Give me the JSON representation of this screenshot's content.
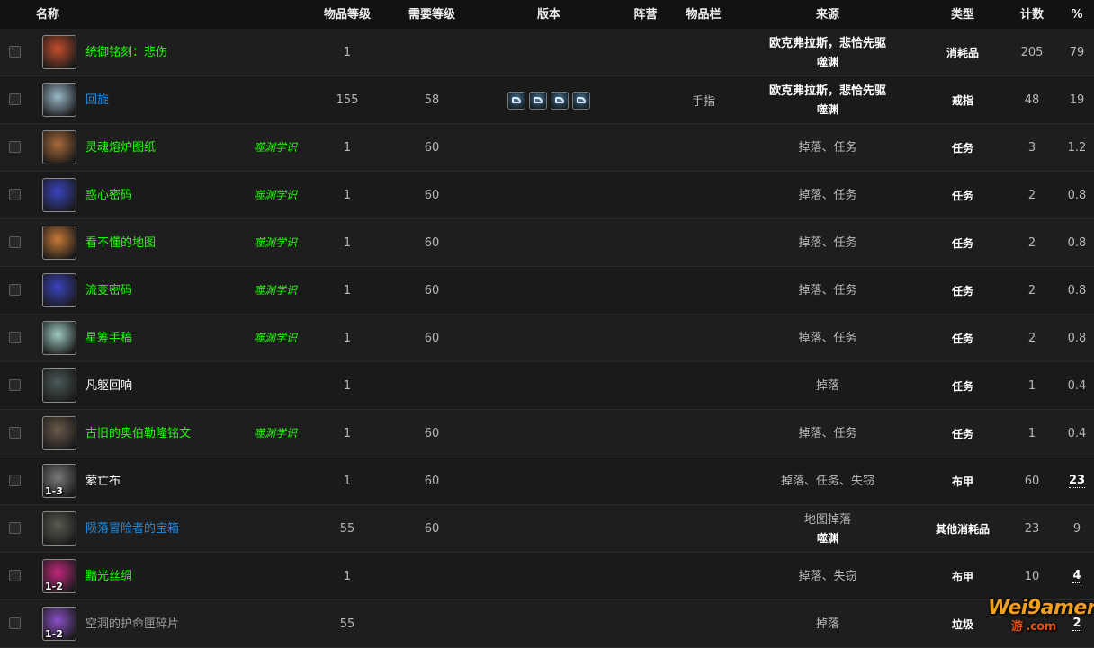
{
  "columns": {
    "name": "名称",
    "item_level": "物品等级",
    "req_level": "需要等级",
    "version": "版本",
    "faction": "阵营",
    "slot": "物品栏",
    "source": "来源",
    "type": "类型",
    "count": "计数",
    "percent": "%"
  },
  "icon_colors": {
    "icon_0": "#c44e2c",
    "icon_1": "#9ab8c8",
    "icon_2": "#a86a3a",
    "icon_3": "#3a44c0",
    "icon_4": "#c87a38",
    "icon_5": "#3a44c0",
    "icon_6": "#9ec8c0",
    "icon_7": "#4a5a58",
    "icon_8": "#6a5a4a",
    "icon_9": "#7a7a7a",
    "icon_10": "#5a5a50",
    "icon_11": "#c0287a",
    "icon_12": "#8a50c8"
  },
  "rows": [
    {
      "icon": "scroll-red-icon",
      "name": "统御铭刻：悲伤",
      "quality": "green",
      "tag": "",
      "item_level": "1",
      "req_level": "",
      "version_icons": 0,
      "slot": "",
      "source": "欧克弗拉斯，悲恰先驱",
      "source_strong": true,
      "zone": "噬渊",
      "type": "消耗品",
      "count": "205",
      "percent": "79",
      "pct_strong": false,
      "badge": ""
    },
    {
      "icon": "ring-icon",
      "name": "回旋",
      "quality": "blue",
      "tag": "",
      "item_level": "155",
      "req_level": "58",
      "version_icons": 4,
      "slot": "手指",
      "source": "欧克弗拉斯，悲恰先驱",
      "source_strong": true,
      "zone": "噬渊",
      "type": "戒指",
      "count": "48",
      "percent": "19",
      "pct_strong": false,
      "badge": ""
    },
    {
      "icon": "parchment-icon",
      "name": "灵魂熔炉图纸",
      "quality": "green",
      "tag": "噬渊学识",
      "item_level": "1",
      "req_level": "60",
      "version_icons": 0,
      "slot": "",
      "source": "掉落、任务",
      "source_strong": false,
      "zone": "",
      "type": "任务",
      "count": "3",
      "percent": "1.2",
      "pct_strong": false,
      "badge": ""
    },
    {
      "icon": "cipher-cube-icon",
      "name": "惑心密码",
      "quality": "green",
      "tag": "噬渊学识",
      "item_level": "1",
      "req_level": "60",
      "version_icons": 0,
      "slot": "",
      "source": "掉落、任务",
      "source_strong": false,
      "zone": "",
      "type": "任务",
      "count": "2",
      "percent": "0.8",
      "pct_strong": false,
      "badge": ""
    },
    {
      "icon": "map-icon",
      "name": "看不懂的地图",
      "quality": "green",
      "tag": "噬渊学识",
      "item_level": "1",
      "req_level": "60",
      "version_icons": 0,
      "slot": "",
      "source": "掉落、任务",
      "source_strong": false,
      "zone": "",
      "type": "任务",
      "count": "2",
      "percent": "0.8",
      "pct_strong": false,
      "badge": ""
    },
    {
      "icon": "cipher-cube-icon",
      "name": "流变密码",
      "quality": "green",
      "tag": "噬渊学识",
      "item_level": "1",
      "req_level": "60",
      "version_icons": 0,
      "slot": "",
      "source": "掉落、任务",
      "source_strong": false,
      "zone": "",
      "type": "任务",
      "count": "2",
      "percent": "0.8",
      "pct_strong": false,
      "badge": ""
    },
    {
      "icon": "manuscript-icon",
      "name": "星筹手稿",
      "quality": "green",
      "tag": "噬渊学识",
      "item_level": "1",
      "req_level": "60",
      "version_icons": 0,
      "slot": "",
      "source": "掉落、任务",
      "source_strong": false,
      "zone": "",
      "type": "任务",
      "count": "2",
      "percent": "0.8",
      "pct_strong": false,
      "badge": ""
    },
    {
      "icon": "echo-orb-icon",
      "name": "凡躯回响",
      "quality": "white",
      "tag": "",
      "item_level": "1",
      "req_level": "",
      "version_icons": 0,
      "slot": "",
      "source": "掉落",
      "source_strong": false,
      "zone": "",
      "type": "任务",
      "count": "1",
      "percent": "0.4",
      "pct_strong": false,
      "badge": ""
    },
    {
      "icon": "rune-tablet-icon",
      "name": "古旧的奥伯勒隆铭文",
      "quality": "green",
      "tag": "噬渊学识",
      "item_level": "1",
      "req_level": "60",
      "version_icons": 0,
      "slot": "",
      "source": "掉落、任务",
      "source_strong": false,
      "zone": "",
      "type": "任务",
      "count": "1",
      "percent": "0.4",
      "pct_strong": false,
      "badge": ""
    },
    {
      "icon": "cloth-icon",
      "name": "萦亡布",
      "quality": "white",
      "tag": "",
      "item_level": "1",
      "req_level": "60",
      "version_icons": 0,
      "slot": "",
      "source": "掉落、任务、失窃",
      "source_strong": false,
      "zone": "",
      "type": "布甲",
      "count": "60",
      "percent": "23",
      "pct_strong": true,
      "badge": "1-3"
    },
    {
      "icon": "treasure-chest-icon",
      "name": "陨落冒险者的宝箱",
      "quality": "blue",
      "tag": "",
      "item_level": "55",
      "req_level": "60",
      "version_icons": 0,
      "slot": "",
      "source": "地图掉落",
      "source_strong": false,
      "zone": "噬渊",
      "type": "其他消耗品",
      "count": "23",
      "percent": "9",
      "pct_strong": false,
      "badge": ""
    },
    {
      "icon": "silk-icon",
      "name": "黯光丝绸",
      "quality": "green",
      "tag": "",
      "item_level": "1",
      "req_level": "",
      "version_icons": 0,
      "slot": "",
      "source": "掉落、失窃",
      "source_strong": false,
      "zone": "",
      "type": "布甲",
      "count": "10",
      "percent": "4",
      "pct_strong": true,
      "badge": "1-2"
    },
    {
      "icon": "shard-icon",
      "name": "空洞的护命匣碎片",
      "quality": "grey",
      "tag": "",
      "item_level": "55",
      "req_level": "",
      "version_icons": 0,
      "slot": "",
      "source": "掉落",
      "source_strong": false,
      "zone": "",
      "type": "垃圾",
      "count": "",
      "percent": "2",
      "pct_strong": true,
      "badge": "1-2"
    }
  ],
  "watermark": {
    "main": "Wei9amer",
    "sub": "游 .com"
  }
}
